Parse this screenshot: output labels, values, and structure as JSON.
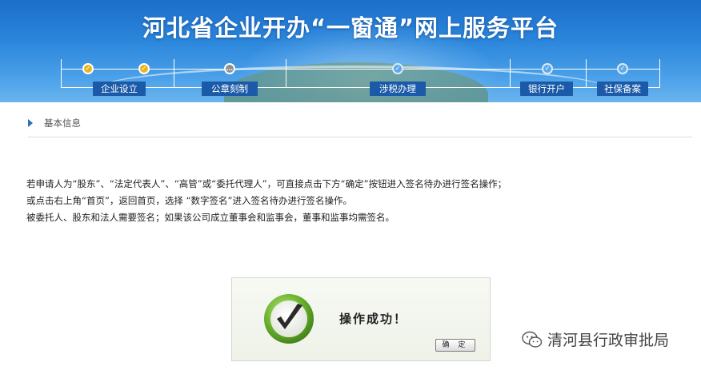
{
  "header": {
    "title": "河北省企业开办“一窗通”网上服务平台"
  },
  "progress": {
    "stages": [
      {
        "label": "企业设立",
        "status": "done"
      },
      {
        "label": "公章刻制",
        "status": "current"
      },
      {
        "label": "涉税办理",
        "status": "todo"
      },
      {
        "label": "银行开户",
        "status": "todo"
      },
      {
        "label": "社保备案",
        "status": "todo"
      }
    ],
    "node_glyphs": {
      "done": "✓",
      "current": "…",
      "todo": "✓"
    }
  },
  "section": {
    "title": "基本信息"
  },
  "info": {
    "lines": [
      "若申请人为“股东”、“法定代表人”、“高管”或“委托代理人”，可直接点击下方“确定”按钮进入签名待办进行签名操作；",
      "或点击右上角“首页”，返回首页，选择 “数字签名”进入签名待办进行签名操作。",
      "被委托人、股东和法人需要签名；如果该公司成立董事会和监事会，董事和监事均需签名。"
    ]
  },
  "dialog": {
    "message": "操作成功！",
    "ok_label": "确 定",
    "icon": "success-check-icon"
  },
  "watermark": {
    "text": "清河县行政审批局",
    "icon": "wechat-icon"
  },
  "colors": {
    "banner": "#2b86db",
    "tab": "#1a5aa8",
    "done_node": "#e8b51c",
    "success_green": "#5da62d"
  }
}
